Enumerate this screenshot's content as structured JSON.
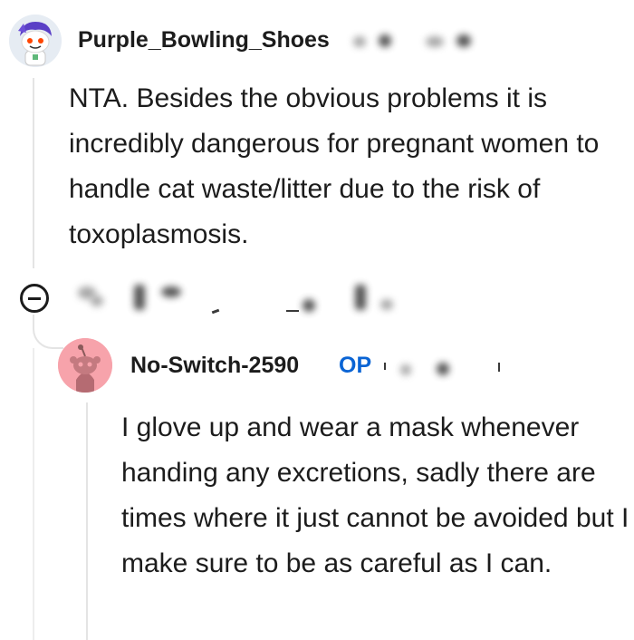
{
  "comment_1": {
    "username": "Purple_Bowling_Shoes",
    "avatar_icon": "snoo-purple-hair-avatar",
    "body": "NTA. Besides the obvious problems it is incredibly dangerous for pregnant women to handle cat waste/litter due to the risk of toxoplasmosis."
  },
  "actions": {
    "collapse_icon": "collapse-minus-icon"
  },
  "comment_2": {
    "username": "No-Switch-2590",
    "badge": "OP",
    "avatar_icon": "snoo-default-avatar",
    "body": "I glove up and wear a mask whenever handing any excretions, sadly there are times where it just cannot be avoided but I make sure to be as careful as I can."
  },
  "colors": {
    "op_badge": "#0a64d4",
    "avatar_2_background": "#f7a3ab",
    "thread_line": "#e4e4e4",
    "text": "#1c1c1c"
  }
}
